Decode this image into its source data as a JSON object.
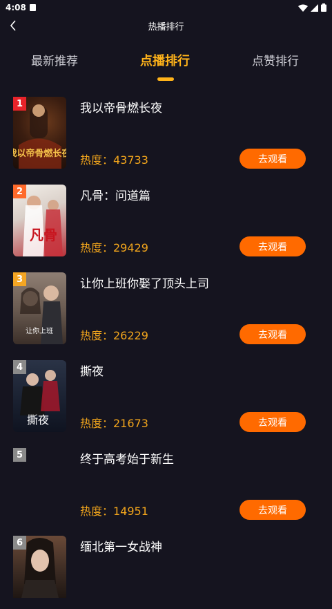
{
  "status_bar": {
    "time": "4:08"
  },
  "header": {
    "title": "热播排行"
  },
  "tabs": [
    {
      "label": "最新推荐",
      "active": false
    },
    {
      "label": "点播排行",
      "active": true
    },
    {
      "label": "点赞排行",
      "active": false
    }
  ],
  "colors": {
    "accent": "#ffb31a",
    "button": "#ff6a00",
    "heat": "#f3a61c",
    "background": "#15141f"
  },
  "list": [
    {
      "rank": "1",
      "title": "我以帝骨燃长夜",
      "heat": "热度：43733",
      "button": "去观看",
      "poster_text": "我以帝骨燃长夜",
      "rank_color": "#e8232a"
    },
    {
      "rank": "2",
      "title": "凡骨：问道篇",
      "heat": "热度：29429",
      "button": "去观看",
      "poster_text": "凡骨",
      "rank_color": "#ff6a2b"
    },
    {
      "rank": "3",
      "title": "让你上班你娶了顶头上司",
      "heat": "热度：26229",
      "button": "去观看",
      "poster_text": "让你上班",
      "rank_color": "#f5a623"
    },
    {
      "rank": "4",
      "title": "撕夜",
      "heat": "热度：21673",
      "button": "去观看",
      "poster_text": "撕夜",
      "rank_color": "#8a8a8a"
    },
    {
      "rank": "5",
      "title": "终于高考始于新生",
      "heat": "热度：14951",
      "button": "去观看",
      "poster_text": "",
      "rank_color": "#8a8a8a"
    },
    {
      "rank": "6",
      "title": "缅北第一女战神",
      "heat": "",
      "button": "",
      "poster_text": "",
      "rank_color": "#8a8a8a"
    }
  ]
}
